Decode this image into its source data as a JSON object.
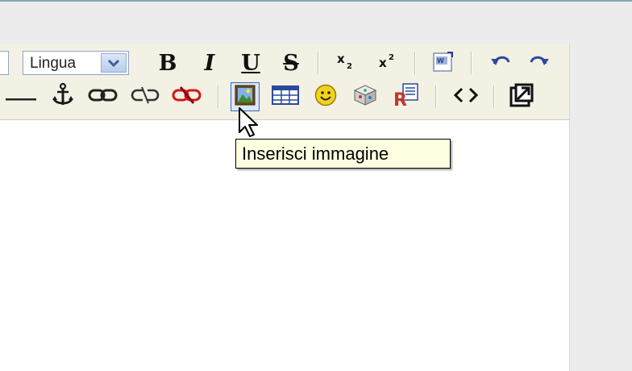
{
  "toolbar": {
    "language_select": {
      "value": "Lingua"
    },
    "row1": [
      {
        "name": "bold-button",
        "icon": "bold-icon",
        "glyph": "B"
      },
      {
        "name": "italic-button",
        "icon": "italic-icon",
        "glyph": "I"
      },
      {
        "name": "underline-button",
        "icon": "underline-icon",
        "glyph": "U"
      },
      {
        "name": "strikethrough-button",
        "icon": "strikethrough-icon",
        "glyph": "S"
      },
      {
        "name": "subscript-button",
        "icon": "subscript-icon",
        "glyph": "x₂"
      },
      {
        "name": "superscript-button",
        "icon": "superscript-icon",
        "glyph": "x²"
      },
      {
        "name": "paste-word-button",
        "icon": "paste-word-icon"
      },
      {
        "name": "undo-button",
        "icon": "undo-icon"
      },
      {
        "name": "redo-button",
        "icon": "redo-icon"
      }
    ],
    "row2": [
      {
        "name": "horizontal-rule-button",
        "icon": "horizontal-rule-icon"
      },
      {
        "name": "anchor-button",
        "icon": "anchor-icon"
      },
      {
        "name": "insert-link-button",
        "icon": "link-icon"
      },
      {
        "name": "unlink-button",
        "icon": "unlink-icon"
      },
      {
        "name": "remove-link-button",
        "icon": "broken-link-icon"
      },
      {
        "name": "insert-image-button",
        "icon": "image-icon"
      },
      {
        "name": "insert-table-button",
        "icon": "table-icon"
      },
      {
        "name": "insert-smiley-button",
        "icon": "smiley-icon"
      },
      {
        "name": "insert-media-button",
        "icon": "media-icon"
      },
      {
        "name": "paste-special-button",
        "icon": "paste-special-icon"
      },
      {
        "name": "source-code-button",
        "icon": "code-icon",
        "glyph": "<>"
      },
      {
        "name": "fullscreen-button",
        "icon": "maximize-icon"
      }
    ]
  },
  "tooltip": {
    "text": "Inserisci immagine"
  },
  "colors": {
    "toolbar_bg": "#f3f0e4",
    "tooltip_bg": "#ffffe1",
    "hover_border": "#316ac5",
    "unlink_red": "#d01818",
    "smiley_yellow": "#f4d21c",
    "undo_blue": "#2a4a9a"
  }
}
